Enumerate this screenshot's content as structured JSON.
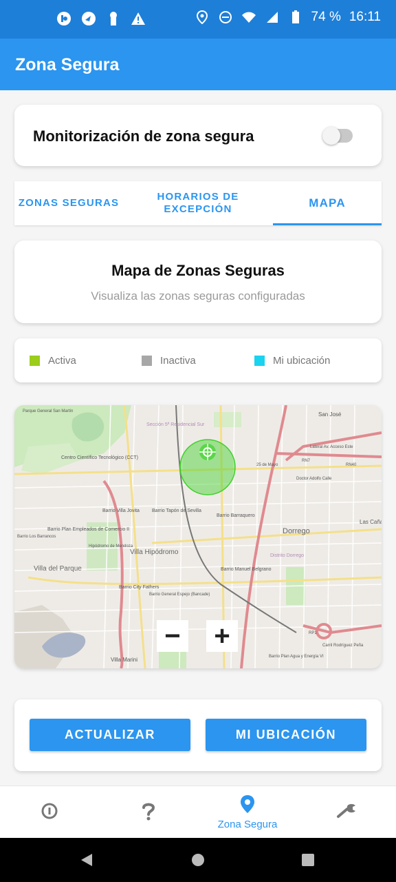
{
  "status_bar": {
    "battery": "74 %",
    "time": "16:11",
    "left_icons": [
      "app-notification-icon",
      "speed-icon",
      "keyhole-icon",
      "warning-icon"
    ],
    "right_icons": [
      "location-icon",
      "do-not-disturb-icon",
      "wifi-icon",
      "signal-icon",
      "battery-icon"
    ]
  },
  "app_bar": {
    "title": "Zona Segura"
  },
  "monitor": {
    "label": "Monitorización de zona segura",
    "enabled": false
  },
  "tabs": [
    {
      "label": "ZONAS SEGURAS"
    },
    {
      "label": "HORARIOS DE EXCEPCIÓN"
    },
    {
      "label": "MAPA",
      "active": true
    }
  ],
  "map_header": {
    "title": "Mapa de Zonas Seguras",
    "subtitle": "Visualiza las zonas seguras configuradas"
  },
  "legend": [
    {
      "label": "Activa",
      "color": "#9bcd1a"
    },
    {
      "label": "Inactiva",
      "color": "#a7a7a7"
    },
    {
      "label": "Mi ubicación",
      "color": "#1ad3ee"
    }
  ],
  "map": {
    "zoom_out": "−",
    "zoom_in": "+",
    "labels": {
      "l1": "Centro Científico Tecnológico (CCT)",
      "l2": "Barrio Villa Jovita",
      "l3": "Barrio Tapón de Sevilla",
      "l4": "Barrio Barraquero",
      "l5": "Villa Hipódromo",
      "l6": "Barrio Manuel Belgrano",
      "l7": "Dorrego",
      "l8": "Distrito Dorrego",
      "l9": "Barrio Plan Empleados de Comercio II",
      "l10": "Villa del Parque",
      "l11": "Hipódromo de Mendoza",
      "l12": "Barrio City Fathers",
      "l13": "Barrio General Espejo (Bancade)",
      "l14": "Barrio Plan Agua y Energía VI",
      "l15": "Villa Marini",
      "l16": "San José",
      "l17": "Las Cañas",
      "l18": "25 de Mayo",
      "l19": "Doctor Adolfo Calle",
      "l20": "Carril Rodríguez Peña",
      "l21": "RN7",
      "l22": "RN40",
      "l23": "RP1",
      "l24": "Sección 5ª Residencial Sur",
      "l25": "Barrio Los Barrancos",
      "l26": "Lateral Av. Acceso Este",
      "l27": "Parque General San Martín"
    },
    "zones": [
      {
        "status": "active",
        "color": "#3fd12b"
      }
    ]
  },
  "actions": {
    "refresh": "ACTUALIZAR",
    "my_location": "MI UBICACIÓN"
  },
  "bottom_nav": {
    "items": [
      {
        "icon": "info-icon",
        "label": ""
      },
      {
        "icon": "help-icon",
        "label": ""
      },
      {
        "icon": "location-pin-icon",
        "label": "Zona Segura",
        "active": true
      },
      {
        "icon": "wrench-icon",
        "label": ""
      }
    ]
  },
  "colors": {
    "primary": "#2b95ef",
    "status_bar": "#1e7fd8",
    "zone_active": "#9bcd1a",
    "zone_inactive": "#a7a7a7",
    "my_location": "#1ad3ee"
  }
}
